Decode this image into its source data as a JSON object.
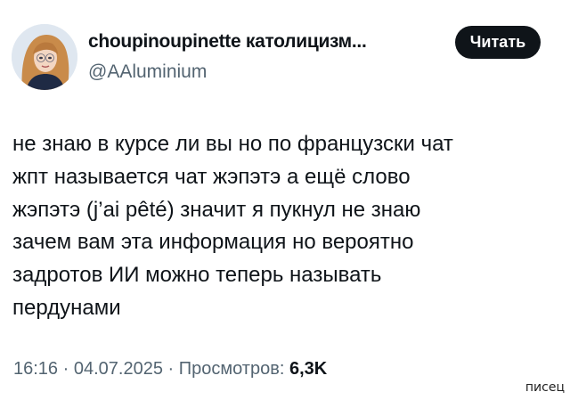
{
  "author": {
    "display_name": "choupinoupinette католицизм...",
    "handle": "@AAluminium",
    "avatar_icon": "profile-photo"
  },
  "actions": {
    "read_label": "Читать"
  },
  "tweet": {
    "lines": [
      "не знаю в курсе ли вы но по французски чат",
      "жпт называется чат жэпэтэ а ещё слово",
      "жэпэтэ (j’ai pêté) значит я пукнул не знаю",
      "зачем вам эта информация но вероятно",
      "задротов ИИ можно теперь называть",
      "пердунами"
    ]
  },
  "meta": {
    "time": "16:16",
    "separator": " · ",
    "date": "04.07.2025",
    "views_label": "Просмотров:",
    "views_count": "6,3K"
  },
  "watermark": "писец",
  "colors": {
    "text": "#0f1419",
    "secondary": "#536471",
    "button_bg": "#0f1419",
    "button_text": "#ffffff"
  }
}
